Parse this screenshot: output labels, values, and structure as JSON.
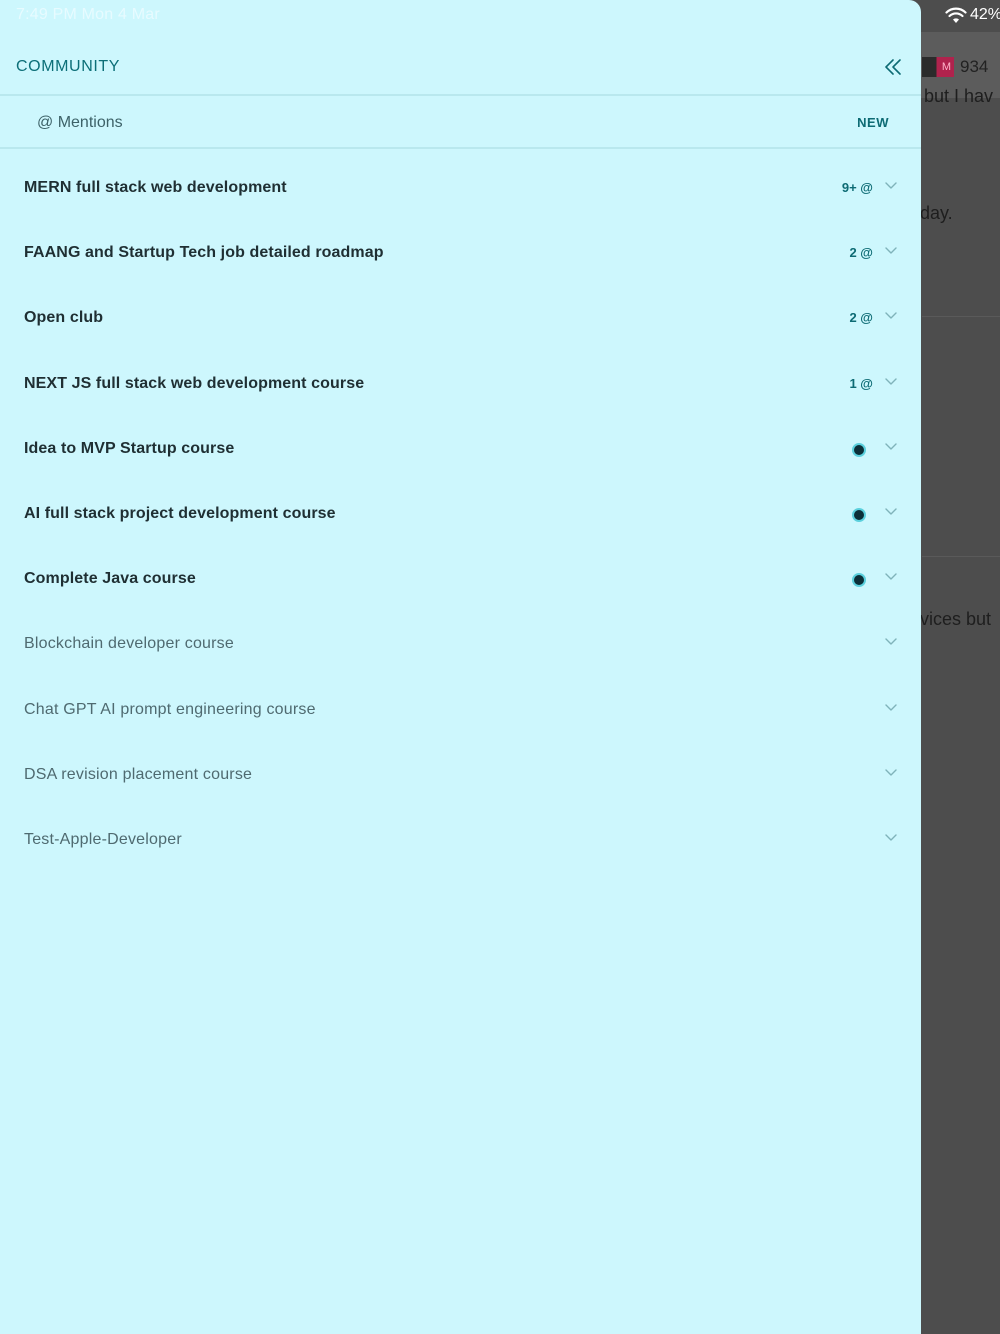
{
  "status_bar": {
    "time": "7:49 PM  Mon 4 Mar",
    "battery": "42%"
  },
  "background": {
    "score": "934",
    "flag_text": "M",
    "snippets": [
      "but I hav",
      "day.",
      "vices but"
    ]
  },
  "drawer": {
    "title": "COMMUNITY",
    "collapse_icon": "double-chevron-left-icon",
    "mentions": {
      "label": "@ Mentions",
      "new_label": "NEW"
    },
    "items": [
      {
        "label": "MERN full stack web development",
        "badge": "9+ @",
        "bold": true
      },
      {
        "label": "FAANG and Startup Tech job detailed roadmap",
        "badge": "2 @",
        "bold": true
      },
      {
        "label": "Open club",
        "badge": "2 @",
        "bold": true
      },
      {
        "label": "NEXT JS full stack web development course",
        "badge": "1 @",
        "bold": true
      },
      {
        "label": "Idea to MVP Startup course",
        "dot": true,
        "bold": true
      },
      {
        "label": "AI full stack project development course",
        "dot": true,
        "bold": true
      },
      {
        "label": "Complete Java course",
        "dot": true,
        "bold": true
      },
      {
        "label": "Blockchain developer course",
        "bold": false
      },
      {
        "label": "Chat GPT AI prompt engineering course",
        "bold": false
      },
      {
        "label": "DSA revision placement course",
        "bold": false
      },
      {
        "label": "Test-Apple-Developer",
        "bold": false
      }
    ]
  },
  "colors": {
    "accent": "#0d6b74",
    "drawer_bg": "#cdf7fd",
    "overlay": "#4d4d4d"
  }
}
